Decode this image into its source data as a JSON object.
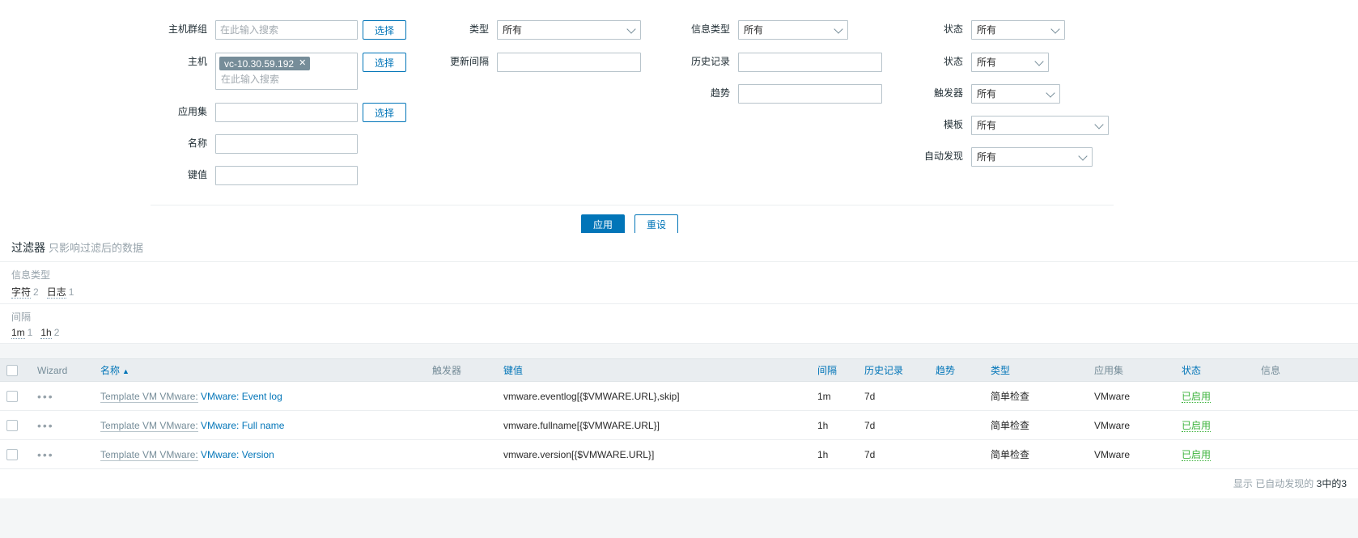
{
  "filter": {
    "col1": [
      {
        "label": "主机群组",
        "placeholder": "在此输入搜索",
        "value": "",
        "button": "选择",
        "type": "multiselect-single"
      },
      {
        "label": "主机",
        "placeholder": "在此输入搜索",
        "chip": "vc-10.30.59.192",
        "button": "选择",
        "type": "multiselect-chip"
      },
      {
        "label": "应用集",
        "placeholder": "",
        "value": "",
        "button": "选择",
        "type": "input-button"
      },
      {
        "label": "名称",
        "placeholder": "",
        "value": "",
        "type": "input"
      },
      {
        "label": "键值",
        "placeholder": "",
        "value": "",
        "type": "input"
      }
    ],
    "col2": [
      {
        "label": "类型",
        "value": "所有",
        "type": "select"
      },
      {
        "label": "更新间隔",
        "value": "",
        "type": "input"
      }
    ],
    "col3": [
      {
        "label": "信息类型",
        "value": "所有",
        "type": "select"
      },
      {
        "label": "历史记录",
        "value": "",
        "type": "input"
      },
      {
        "label": "趋势",
        "value": "",
        "type": "input"
      }
    ],
    "col4": [
      {
        "label": "状态",
        "value": "所有",
        "type": "select"
      },
      {
        "label": "状态",
        "value": "所有",
        "type": "select"
      },
      {
        "label": "触发器",
        "value": "所有",
        "type": "select"
      },
      {
        "label": "模板",
        "value": "所有",
        "type": "select"
      },
      {
        "label": "自动发现",
        "value": "所有",
        "type": "select"
      }
    ],
    "apply_label": "应用",
    "reset_label": "重设",
    "remove_icon": "close-icon",
    "dropdown_icon": "chevron-down-icon"
  },
  "subfilter": {
    "title": "过滤器",
    "title_note": "只影响过滤后的数据",
    "groups": [
      {
        "name": "信息类型",
        "options": [
          {
            "label": "字符",
            "count": "2"
          },
          {
            "label": "日志",
            "count": "1"
          }
        ]
      },
      {
        "name": "间隔",
        "options": [
          {
            "label": "1m",
            "count": "1"
          },
          {
            "label": "1h",
            "count": "2"
          }
        ]
      }
    ]
  },
  "table": {
    "headers": {
      "checkbox": "",
      "wizard": "Wizard",
      "name": "名称",
      "sort_arrow": "▲",
      "triggers": "触发器",
      "key": "键值",
      "interval": "间隔",
      "history": "历史记录",
      "trends": "趋势",
      "type": "类型",
      "applications": "应用集",
      "status": "状态",
      "info": "信息"
    },
    "rows": [
      {
        "wizard": "•••",
        "template_prefix": "Template VM VMware:",
        "name": "VMware: Event log",
        "triggers": "",
        "key": "vmware.eventlog[{$VMWARE.URL},skip]",
        "interval": "1m",
        "history": "7d",
        "trends": "",
        "type": "简单检查",
        "applications": "VMware",
        "status": "已启用",
        "info": ""
      },
      {
        "wizard": "•••",
        "template_prefix": "Template VM VMware:",
        "name": "VMware: Full name",
        "triggers": "",
        "key": "vmware.fullname[{$VMWARE.URL}]",
        "interval": "1h",
        "history": "7d",
        "trends": "",
        "type": "简单检查",
        "applications": "VMware",
        "status": "已启用",
        "info": ""
      },
      {
        "wizard": "•••",
        "template_prefix": "Template VM VMware:",
        "name": "VMware: Version",
        "triggers": "",
        "key": "vmware.version[{$VMWARE.URL}]",
        "interval": "1h",
        "history": "7d",
        "trends": "",
        "type": "简单检查",
        "applications": "VMware",
        "status": "已启用",
        "info": ""
      }
    ],
    "footer_prefix": "显示",
    "footer_note": "已自动发现的",
    "footer_count": "3中的3"
  },
  "colors": {
    "accent": "#0275b8",
    "status_enabled": "#3db33d",
    "chip_bg": "#768d99",
    "header_bg": "#e9edf0",
    "muted": "#97a3ab"
  }
}
